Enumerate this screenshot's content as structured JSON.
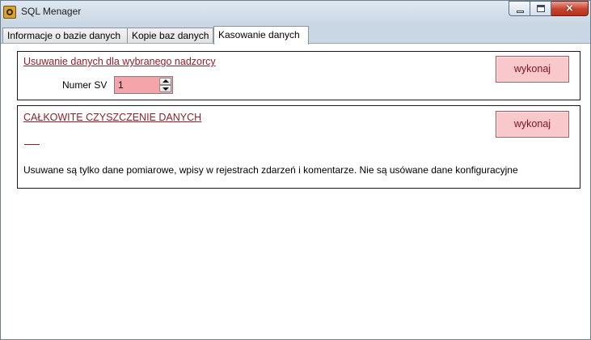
{
  "window": {
    "title": "SQL Menager",
    "controls": {
      "close_symbol": "×"
    }
  },
  "tabs": [
    {
      "label": "Informacje o bazie danych"
    },
    {
      "label": "Kopie baz danych"
    },
    {
      "label": "Kasowanie danych",
      "selected": true
    }
  ],
  "section_selected": {
    "title": "Usuwanie danych dla wybranego nadzorcy",
    "field_label": "Numer SV",
    "field_value": "1",
    "button_label": "wykonaj"
  },
  "section_full": {
    "title": "CAŁKOWITE CZYSZCZENIE DANYCH",
    "button_label": "wykonaj",
    "note": "Usuwane są tylko dane pomiarowe, wpisy w rejestrach zdarzeń i komentarze. Nie są usówane dane konfiguracyjne"
  },
  "colors": {
    "title_text": "#8f1f2b",
    "button_fill": "#f8c8cb",
    "button_border": "#c84a52",
    "input_fill": "#f5a5a9"
  },
  "icons": {
    "app": "app-logo-icon",
    "minimize": "minimize-icon",
    "maximize": "maximize-icon",
    "close": "close-icon",
    "spin_up": "arrow-up-icon",
    "spin_down": "arrow-down-icon"
  }
}
